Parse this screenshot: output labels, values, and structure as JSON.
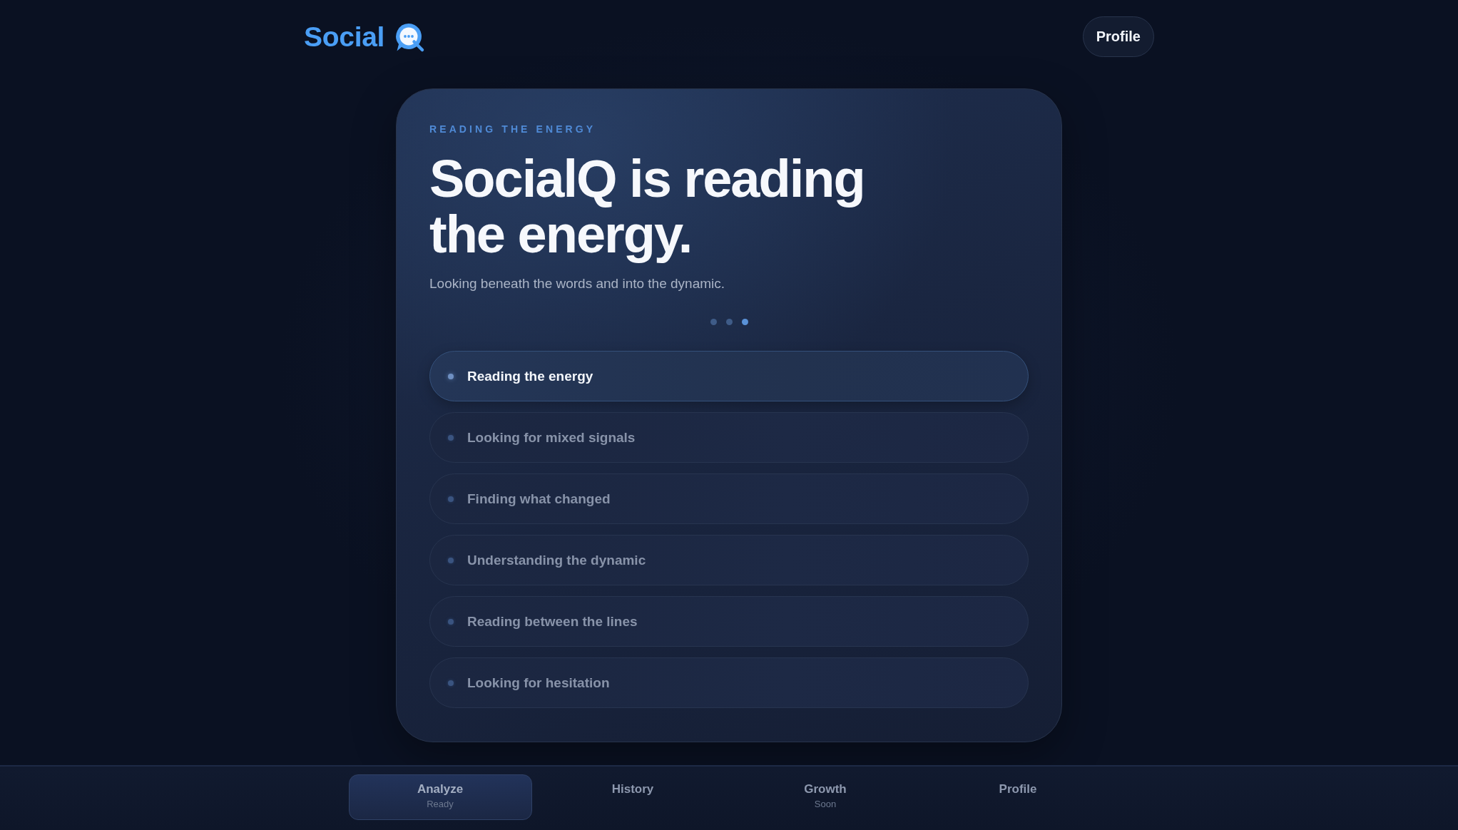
{
  "header": {
    "brand": "Social",
    "profile_button": "Profile"
  },
  "card": {
    "eyebrow": "READING THE ENERGY",
    "title": "SocialQ is reading the energy.",
    "subtitle": "Looking beneath the words and into the dynamic.",
    "loading_dots": [
      {
        "active": false
      },
      {
        "active": false
      },
      {
        "active": true
      }
    ],
    "steps": [
      {
        "label": "Reading the energy",
        "active": true
      },
      {
        "label": "Looking for mixed signals",
        "active": false
      },
      {
        "label": "Finding what changed",
        "active": false
      },
      {
        "label": "Understanding the dynamic",
        "active": false
      },
      {
        "label": "Reading between the lines",
        "active": false
      },
      {
        "label": "Looking for hesitation",
        "active": false
      }
    ]
  },
  "bottom_nav": [
    {
      "label": "Analyze",
      "sublabel": "Ready",
      "selected": true
    },
    {
      "label": "History",
      "selected": false
    },
    {
      "label": "Growth",
      "sublabel": "Soon",
      "selected": false
    },
    {
      "label": "Profile",
      "selected": false
    }
  ]
}
